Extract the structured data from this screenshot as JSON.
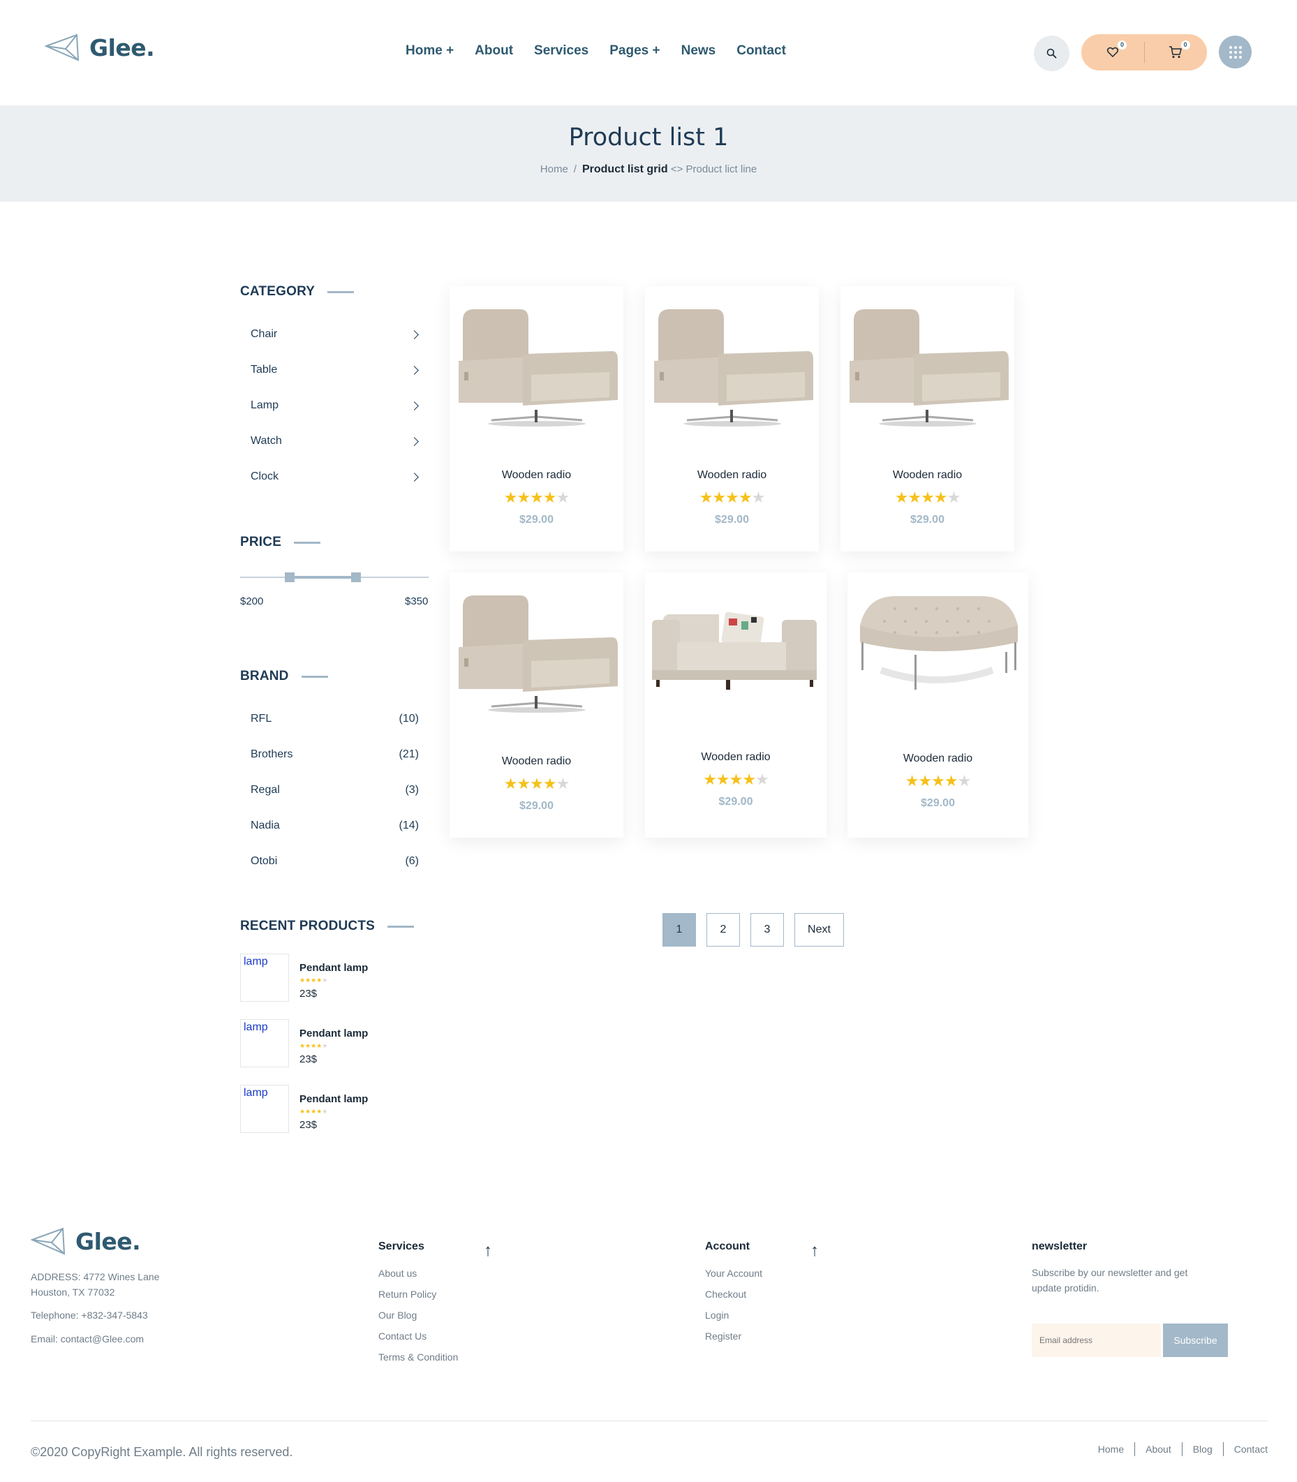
{
  "brand": {
    "name": "Glee."
  },
  "nav": [
    "Home +",
    "About",
    "Services",
    "Pages +",
    "News",
    "Contact"
  ],
  "header_icons": {
    "wishlist_count": "0",
    "cart_count": "0"
  },
  "banner": {
    "title": "Product list 1",
    "crumb_home": "Home",
    "crumb_sep": "/",
    "crumb_current": "Product list grid",
    "crumb_extra": "<> Product lict line"
  },
  "sidebar": {
    "category_title": "CATEGORY",
    "categories": [
      "Chair",
      "Table",
      "Lamp",
      "Watch",
      "Clock"
    ],
    "price_title": "PRICE",
    "price_min": "$200",
    "price_max": "$350",
    "price_range_fraction": [
      0.25,
      0.6
    ],
    "brand_title": "BRAND",
    "brands": [
      {
        "name": "RFL",
        "count": "(10)"
      },
      {
        "name": "Brothers",
        "count": "(21)"
      },
      {
        "name": "Regal",
        "count": "(3)"
      },
      {
        "name": "Nadia",
        "count": "(14)"
      },
      {
        "name": "Otobi",
        "count": "(6)"
      }
    ],
    "recent_title": "RECENT PRODUCTS",
    "recent": [
      {
        "img_alt": "lamp",
        "name": "Pendant lamp",
        "rating": 4,
        "price": "23$"
      },
      {
        "img_alt": "lamp",
        "name": "Pendant lamp",
        "rating": 4,
        "price": "23$"
      },
      {
        "img_alt": "lamp",
        "name": "Pendant lamp",
        "rating": 4,
        "price": "23$"
      }
    ]
  },
  "products": [
    {
      "name": "Wooden radio",
      "rating": 4,
      "price": "$29.00",
      "image": "armchair"
    },
    {
      "name": "Wooden radio",
      "rating": 4,
      "price": "$29.00",
      "image": "armchair"
    },
    {
      "name": "Wooden radio",
      "rating": 4,
      "price": "$29.00",
      "image": "armchair"
    },
    {
      "name": "Wooden radio",
      "rating": 4,
      "price": "$29.00",
      "image": "armchair"
    },
    {
      "name": "Wooden radio",
      "rating": 4,
      "price": "$29.00",
      "image": "sofa-chair"
    },
    {
      "name": "Wooden radio",
      "rating": 4,
      "price": "$29.00",
      "image": "ottoman"
    }
  ],
  "pagination": {
    "pages": [
      "1",
      "2",
      "3"
    ],
    "next": "Next",
    "active": "1"
  },
  "footer": {
    "address_line1": "ADDRESS: 4772 Wines Lane",
    "address_line2": "Houston, TX 77032",
    "telephone": "Telephone: +832-347-5843",
    "email": "Email: contact@Glee.com",
    "services_title": "Services",
    "services": [
      "About us",
      "Return Policy",
      "Our Blog",
      "Contact Us",
      "Terms & Condition"
    ],
    "account_title": "Account",
    "account": [
      "Your Account",
      "Checkout",
      "Login",
      "Register"
    ],
    "newsletter_title": "newsletter",
    "newsletter_text": "Subscribe by our newsletter and get update protidin.",
    "email_placeholder": "Email address",
    "subscribe": "Subscribe",
    "copyright": "©2020 CopyRight Example. All rights reserved.",
    "bottom_links": [
      "Home",
      "About",
      "Blog",
      "Contact"
    ]
  },
  "colors": {
    "accent": "#a3b8c8",
    "navy": "#1f3b55",
    "peach": "#f9cda9",
    "star": "#f5c11a"
  }
}
